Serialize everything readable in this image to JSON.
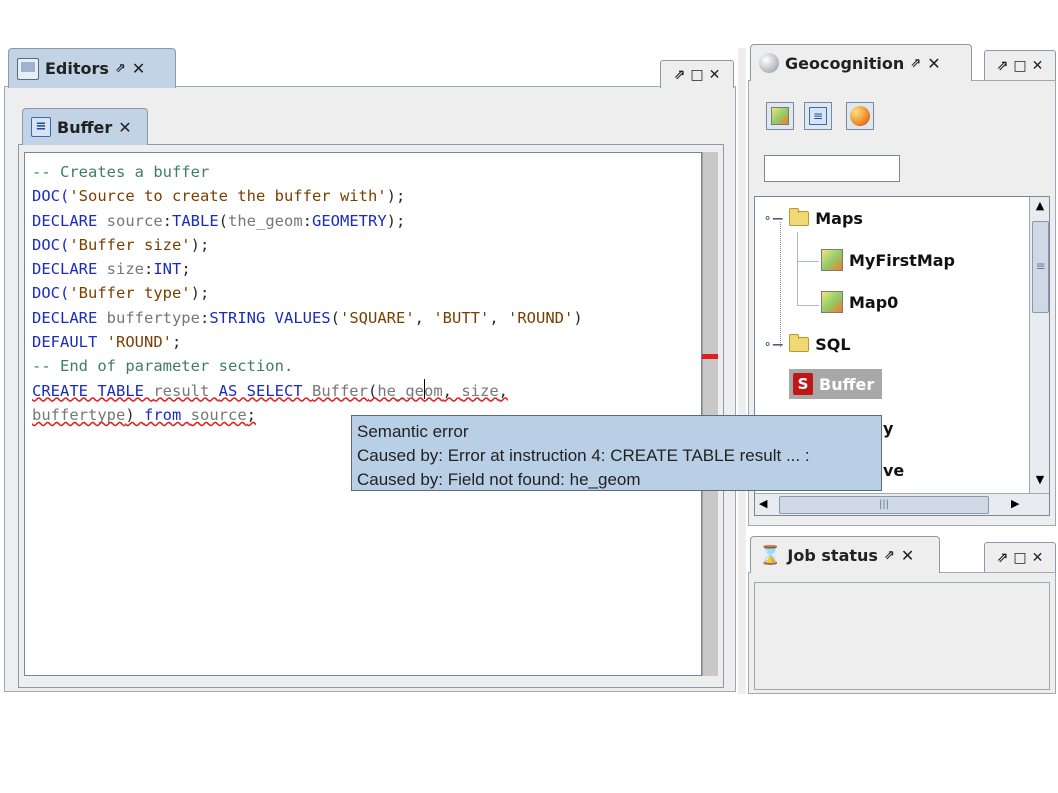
{
  "editors_panel": {
    "tab_label": "Editors",
    "pin_glyph": "⇗",
    "close_glyph": "✕",
    "controls": {
      "pin": "⇗",
      "restore": "□",
      "close": "✕"
    }
  },
  "buffer_tab": {
    "label": "Buffer",
    "close_glyph": "✕"
  },
  "code": {
    "lines": [
      [
        {
          "t": "-- Creates a buffer",
          "c": "cm"
        }
      ],
      [
        {
          "t": "DOC(",
          "c": "kw"
        },
        {
          "t": "'Source to create the buffer with'",
          "c": "str"
        },
        {
          "t": ");",
          "c": ""
        }
      ],
      [
        {
          "t": "DECLARE ",
          "c": "kw"
        },
        {
          "t": "source",
          "c": "id"
        },
        {
          "t": ":",
          "c": ""
        },
        {
          "t": "TABLE",
          "c": "kw"
        },
        {
          "t": "(",
          "c": ""
        },
        {
          "t": "the_geom",
          "c": "id"
        },
        {
          "t": ":",
          "c": ""
        },
        {
          "t": "GEOMETRY",
          "c": "kw"
        },
        {
          "t": ");",
          "c": ""
        }
      ],
      [
        {
          "t": "DOC(",
          "c": "kw"
        },
        {
          "t": "'Buffer size'",
          "c": "str"
        },
        {
          "t": ");",
          "c": ""
        }
      ],
      [
        {
          "t": "DECLARE ",
          "c": "kw"
        },
        {
          "t": "size",
          "c": "id"
        },
        {
          "t": ":",
          "c": ""
        },
        {
          "t": "INT",
          "c": "kw"
        },
        {
          "t": ";",
          "c": ""
        }
      ],
      [
        {
          "t": "DOC(",
          "c": "kw"
        },
        {
          "t": "'Buffer type'",
          "c": "str"
        },
        {
          "t": ");",
          "c": ""
        }
      ],
      [
        {
          "t": "DECLARE ",
          "c": "kw"
        },
        {
          "t": "buffertype",
          "c": "id"
        },
        {
          "t": ":",
          "c": ""
        },
        {
          "t": "STRING VALUES",
          "c": "kw"
        },
        {
          "t": "(",
          "c": ""
        },
        {
          "t": "'SQUARE'",
          "c": "str"
        },
        {
          "t": ", ",
          "c": ""
        },
        {
          "t": "'BUTT'",
          "c": "str"
        },
        {
          "t": ", ",
          "c": ""
        },
        {
          "t": "'ROUND'",
          "c": "str"
        },
        {
          "t": ")",
          "c": ""
        }
      ],
      [
        {
          "t": "DEFAULT ",
          "c": "kw"
        },
        {
          "t": "'ROUND'",
          "c": "str"
        },
        {
          "t": ";",
          "c": ""
        }
      ],
      [
        {
          "t": "-- End of parameter section.",
          "c": "cm"
        }
      ],
      [
        {
          "t": "CREATE TABLE ",
          "c": "kw err"
        },
        {
          "t": "result ",
          "c": "id err"
        },
        {
          "t": "AS SELECT ",
          "c": "kw err"
        },
        {
          "t": "Buffer",
          "c": "id err"
        },
        {
          "t": "(",
          "c": "err"
        },
        {
          "t": "he_geom",
          "c": "id err"
        },
        {
          "t": ", ",
          "c": "err"
        },
        {
          "t": "size",
          "c": "id err"
        },
        {
          "t": ",",
          "c": "err"
        }
      ],
      [
        {
          "t": "buffertype",
          "c": "id err"
        },
        {
          "t": ") ",
          "c": "err"
        },
        {
          "t": "from ",
          "c": "kw err"
        },
        {
          "t": "source",
          "c": "id err"
        },
        {
          "t": ";",
          "c": "err"
        }
      ]
    ]
  },
  "tooltip": {
    "line1": "Semantic error",
    "line2": "Caused by: Error at instruction 4: CREATE TABLE result ... :",
    "line3": "Caused by: Field not found: he_geom"
  },
  "geocognition_panel": {
    "tab_label": "Geocognition",
    "pin_glyph": "⇗",
    "close_glyph": "✕",
    "controls": {
      "pin": "⇗",
      "restore": "□",
      "close": "✕"
    },
    "filter_value": "",
    "tree": {
      "maps": "Maps",
      "map1": "MyFirstMap",
      "map2": "Map0",
      "sql": "SQL",
      "buffer": "Buffer",
      "partial1": "y",
      "partial2": "ve"
    },
    "hscroll_thumb_glyph": "|||",
    "vscroll_thumb_glyph": "≡",
    "arrows": {
      "up": "▲",
      "down": "▼",
      "left": "◀",
      "right": "▶"
    }
  },
  "job_status_panel": {
    "tab_label": "Job status",
    "pin_glyph": "⇗",
    "close_glyph": "✕",
    "controls": {
      "pin": "⇗",
      "restore": "□",
      "close": "✕"
    }
  },
  "colors": {
    "active_tab": "#c3d3e6",
    "tooltip_bg": "#b8cfe5",
    "error_marker": "#e02020",
    "keyword": "#1a2bc0"
  }
}
